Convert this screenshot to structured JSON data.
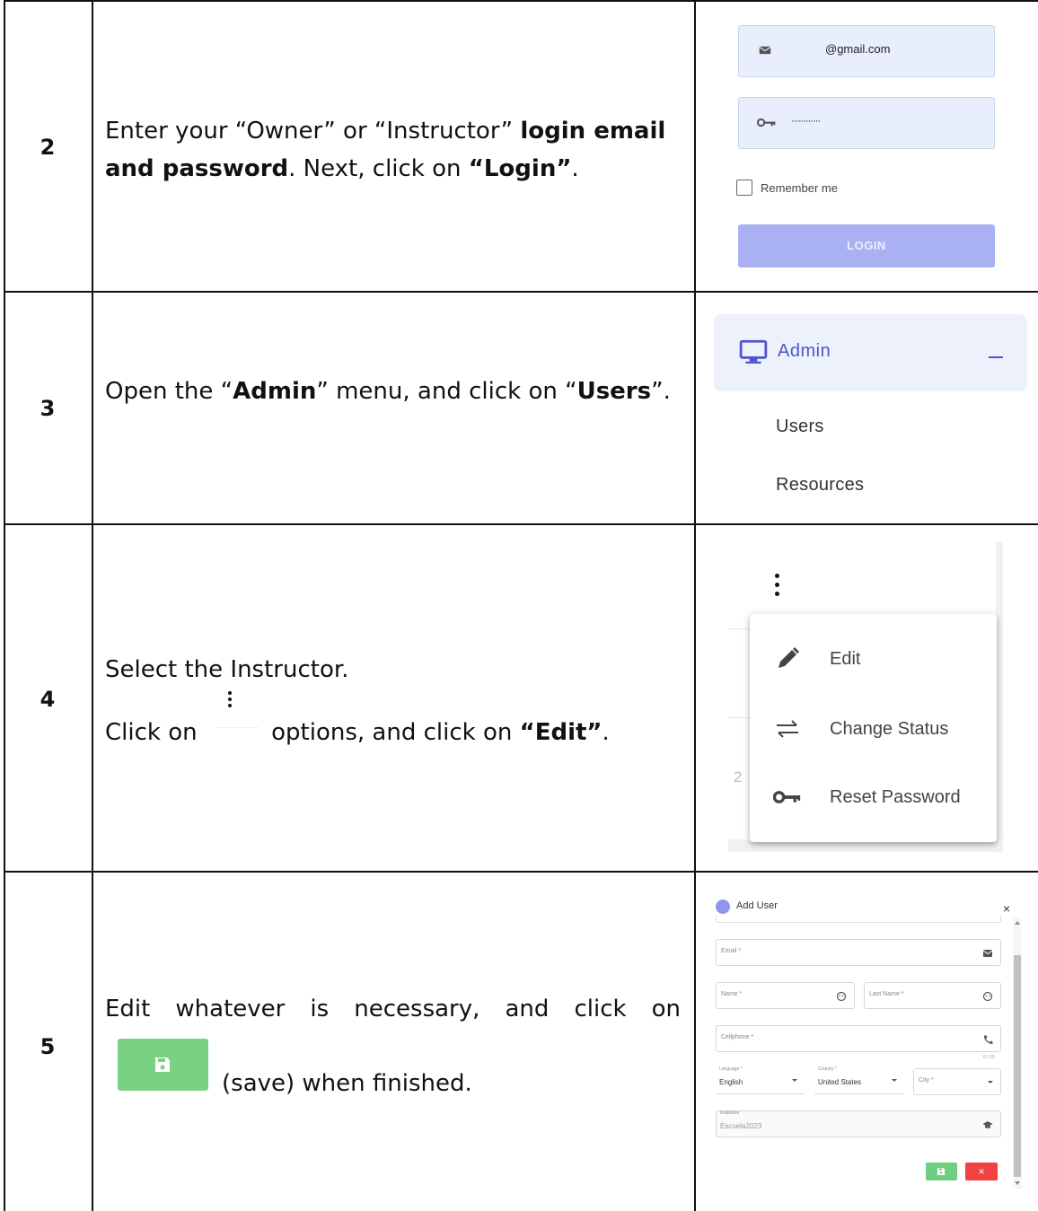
{
  "rows": [
    {
      "number": "2",
      "text": {
        "p1": "Enter your “Owner” or “Instructor” ",
        "b1": "login email and password",
        "p2": ". Next, click on ",
        "b2": "“Login”",
        "p3": "."
      }
    },
    {
      "number": "3",
      "text": {
        "p1": "Open the “",
        "b1": "Admin",
        "p2": "” menu, and click on “",
        "b2": "Users",
        "p3": "”."
      }
    },
    {
      "number": "4",
      "text": {
        "line1": "Select the Instructor.",
        "p1": "Click on ",
        "p2": " options, and click on ",
        "b1": "“Edit”",
        "p3": "."
      }
    },
    {
      "number": "5",
      "text": {
        "line1": "Edit whatever is necessary, and click on",
        "p2": "(save) when finished."
      }
    }
  ],
  "login_form": {
    "email_value": "@gmail.com",
    "password_value": "············",
    "remember_label": "Remember me",
    "login_label": "LOGIN",
    "accent_color": "#aab1f2"
  },
  "admin_menu": {
    "title": "Admin",
    "items": [
      "Users",
      "Resources"
    ],
    "accent_color": "#4f55cf"
  },
  "options_menu": {
    "ghost_text": "2",
    "items": [
      {
        "label": "Edit",
        "icon": "pencil-icon"
      },
      {
        "label": "Change Status",
        "icon": "swap-arrows-icon"
      },
      {
        "label": "Reset Password",
        "icon": "key-icon"
      }
    ]
  },
  "add_user_dialog": {
    "title": "Add User",
    "close": "×",
    "email_placeholder": "Email *",
    "name_placeholder": "Name *",
    "lastname_placeholder": "Last Name *",
    "cellphone_placeholder": "Cellphone *",
    "cellphone_counter": "0 / 10",
    "language_label": "Language *",
    "language_value": "English",
    "country_label": "Country *",
    "country_value": "United States",
    "city_placeholder": "City *",
    "institution_label": "Institution",
    "institution_value": "Escuela2023",
    "cancel_symbol": "×",
    "save_color": "#6ed07f",
    "cancel_color": "#f24141"
  }
}
